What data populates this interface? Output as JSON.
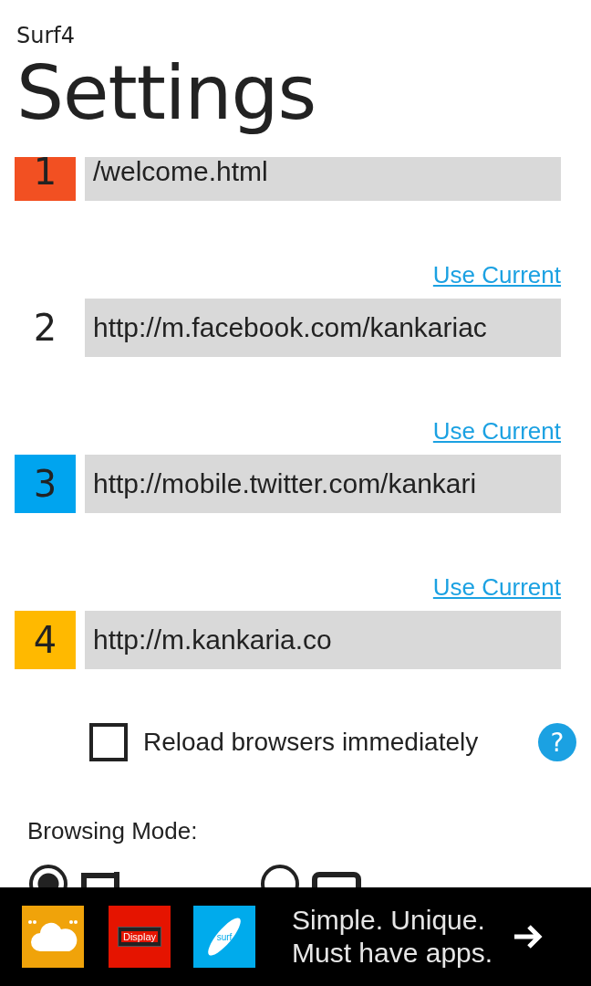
{
  "app_name": "Surf4",
  "title": "Settings",
  "home_pages": [
    {
      "number": "1",
      "color": "#f25022",
      "url": "/welcome.html"
    },
    {
      "number": "2",
      "link": "Use Current",
      "url": "http://m.facebook.com/kankariac"
    },
    {
      "number": "3",
      "color": "#00a4ef",
      "link": "Use Current",
      "url": "http://mobile.twitter.com/kankari"
    },
    {
      "number": "4",
      "color": "#ffb900",
      "link": "Use Current",
      "url": "http://m.kankaria.co"
    }
  ],
  "reload_option": {
    "label": "Reload browsers immediately",
    "checked": false,
    "help": "?"
  },
  "browsing_mode": {
    "label": "Browsing Mode:",
    "options": [
      {
        "kind": "portrait",
        "selected": true
      },
      {
        "kind": "landscape",
        "selected": false
      }
    ]
  },
  "ad_bar": {
    "tiles": [
      {
        "kind": "cloud",
        "color": "#f0a30a"
      },
      {
        "kind": "display",
        "color": "#e51400",
        "text": "Display"
      },
      {
        "kind": "surf",
        "color": "#00abec",
        "text": "surf"
      }
    ],
    "tagline": [
      "Simple. Unique.",
      "Must have apps."
    ]
  }
}
